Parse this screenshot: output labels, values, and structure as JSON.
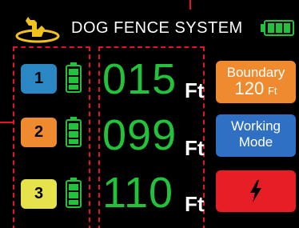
{
  "header": {
    "title": "DOG FENCE SYSTEM",
    "logo_icon": "dog-logo-icon",
    "battery_icon": "battery-full-icon"
  },
  "devices": [
    {
      "id": "1",
      "color": "#2b86c4",
      "distance": "015",
      "unit": "Ft"
    },
    {
      "id": "2",
      "color": "#ef8a2e",
      "distance": "099",
      "unit": "Ft"
    },
    {
      "id": "3",
      "color": "#e6e24c",
      "distance": "110",
      "unit": "Ft"
    }
  ],
  "buttons": {
    "boundary": {
      "label": "Boundary",
      "value": "120",
      "unit": "Ft"
    },
    "working": {
      "line1": "Working",
      "line2": "Mode"
    },
    "alert": {
      "icon": "lightning-bolt-icon"
    }
  },
  "colors": {
    "distance_text": "#22c23a",
    "battery": "#22c23a",
    "dashed_frame": "#e8102a"
  }
}
